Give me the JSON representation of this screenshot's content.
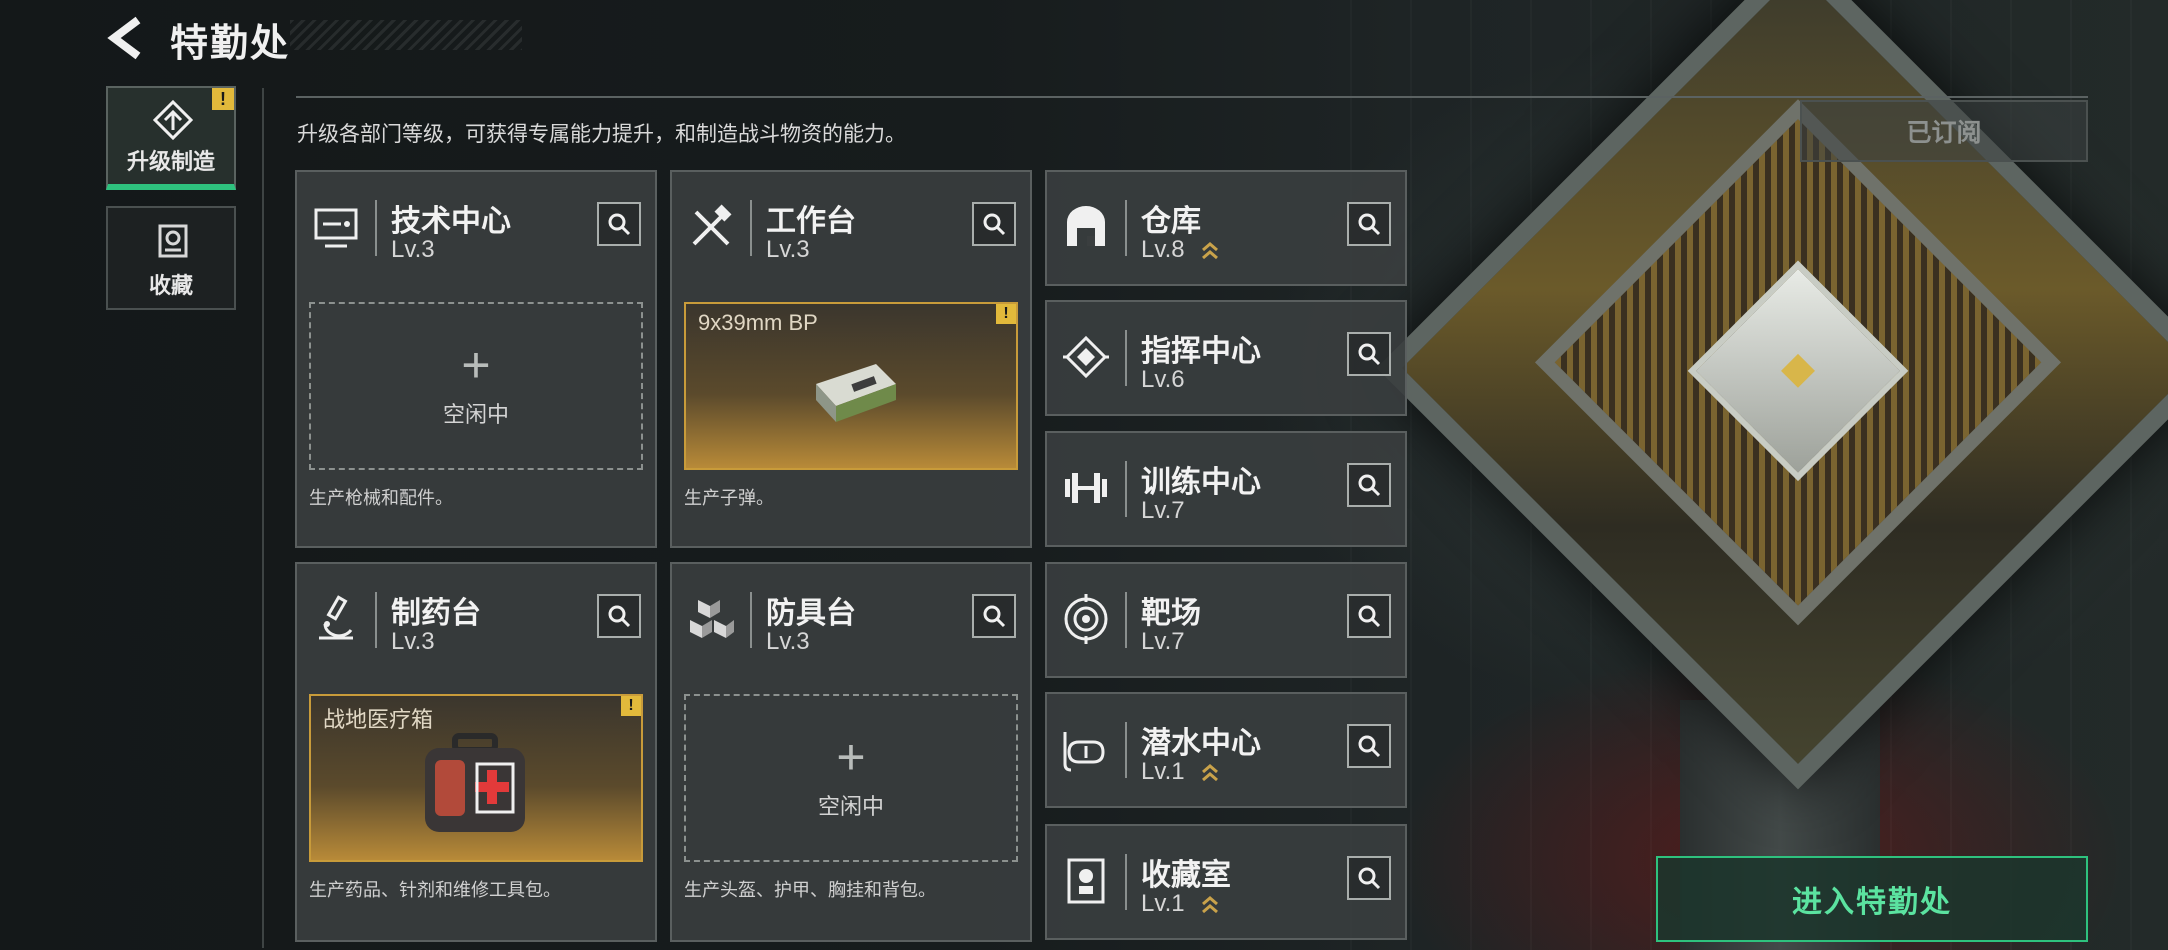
{
  "header": {
    "title": "特勤处"
  },
  "sidebar": {
    "items": [
      {
        "label": "升级制造",
        "active": true,
        "alert": "!"
      },
      {
        "label": "收藏",
        "active": false
      }
    ]
  },
  "intro_text": "升级各部门等级，可获得专属能力提升，和制造战斗物资的能力。",
  "subscribed_label": "已订阅",
  "enter_button": "进入特勤处",
  "idle_plus": "+",
  "workshops": [
    {
      "name": "技术中心",
      "level": "Lv.3",
      "slot": {
        "state": "idle",
        "label": "空闲中"
      },
      "desc": "生产枪械和配件。"
    },
    {
      "name": "工作台",
      "level": "Lv.3",
      "slot": {
        "state": "item",
        "item": "9x39mm BP",
        "alert": "!"
      },
      "desc": "生产子弹。"
    },
    {
      "name": "制药台",
      "level": "Lv.3",
      "slot": {
        "state": "item",
        "item": "战地医疗箱",
        "alert": "!"
      },
      "desc": "生产药品、针剂和维修工具包。"
    },
    {
      "name": "防具台",
      "level": "Lv.3",
      "slot": {
        "state": "idle",
        "label": "空闲中"
      },
      "desc": "生产头盔、护甲、胸挂和背包。"
    }
  ],
  "facilities": [
    {
      "name": "仓库",
      "level": "Lv.8",
      "upgradable": true,
      "icon": "warehouse-icon"
    },
    {
      "name": "指挥中心",
      "level": "Lv.6",
      "upgradable": false,
      "icon": "command-chip-icon"
    },
    {
      "name": "训练中心",
      "level": "Lv.7",
      "upgradable": false,
      "icon": "dumbbell-icon"
    },
    {
      "name": "靶场",
      "level": "Lv.7",
      "upgradable": false,
      "icon": "target-icon"
    },
    {
      "name": "潜水中心",
      "level": "Lv.1",
      "upgradable": true,
      "icon": "diving-mask-icon"
    },
    {
      "name": "收藏室",
      "level": "Lv.1",
      "upgradable": true,
      "icon": "collection-room-icon"
    }
  ],
  "colors": {
    "accent_green": "#2ec27e",
    "alert_yellow": "#e2b93b",
    "upgrade_gold": "#c9a24a"
  }
}
